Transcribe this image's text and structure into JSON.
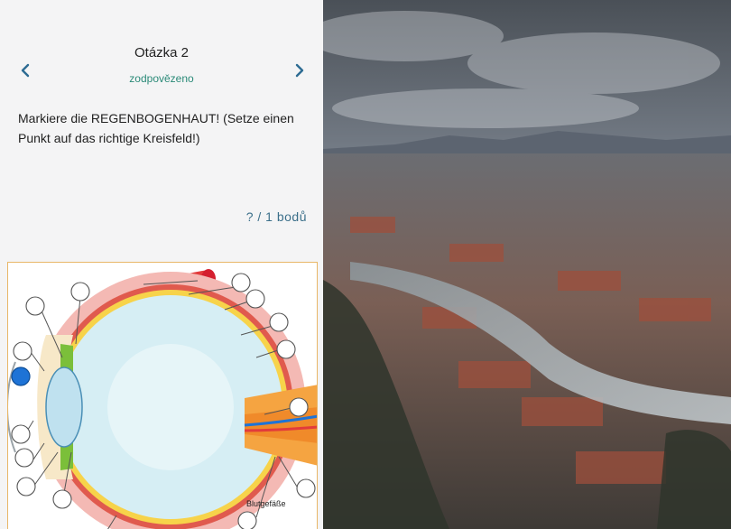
{
  "question": {
    "title": "Otázka 2",
    "status": "zodpovězeno",
    "text": "Markiere die REGENBOGENHAUT! (Setze einen Punkt auf das richtige Kreisfeld!)",
    "points": "? / 1 bodů"
  },
  "icons": {
    "prev": "chevron-left-icon",
    "next": "chevron-right-icon"
  },
  "diagram": {
    "label_blood_vessels": "Blutgefäße",
    "selected_marker_color": "#1e73d6"
  },
  "colors": {
    "status": "#2b8a78",
    "points": "#3b6f8a",
    "diagram_border": "#e8b768"
  }
}
